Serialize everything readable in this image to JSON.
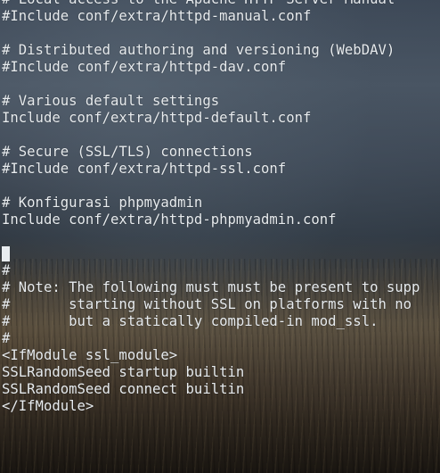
{
  "editor": {
    "lines": [
      "# Local access to the Apache HTTP Server Manual",
      "#Include conf/extra/httpd-manual.conf",
      "",
      "# Distributed authoring and versioning (WebDAV)",
      "#Include conf/extra/httpd-dav.conf",
      "",
      "# Various default settings",
      "Include conf/extra/httpd-default.conf",
      "",
      "# Secure (SSL/TLS) connections",
      "#Include conf/extra/httpd-ssl.conf",
      "",
      "# Konfigurasi phpmyadmin",
      "Include conf/extra/httpd-phpmyadmin.conf",
      "",
      "",
      "#",
      "# Note: The following must must be present to supp",
      "#       starting without SSL on platforms with no",
      "#       but a statically compiled-in mod_ssl.",
      "#",
      "<IfModule ssl_module>",
      "SSLRandomSeed startup builtin",
      "SSLRandomSeed connect builtin",
      "</IfModule>"
    ]
  }
}
